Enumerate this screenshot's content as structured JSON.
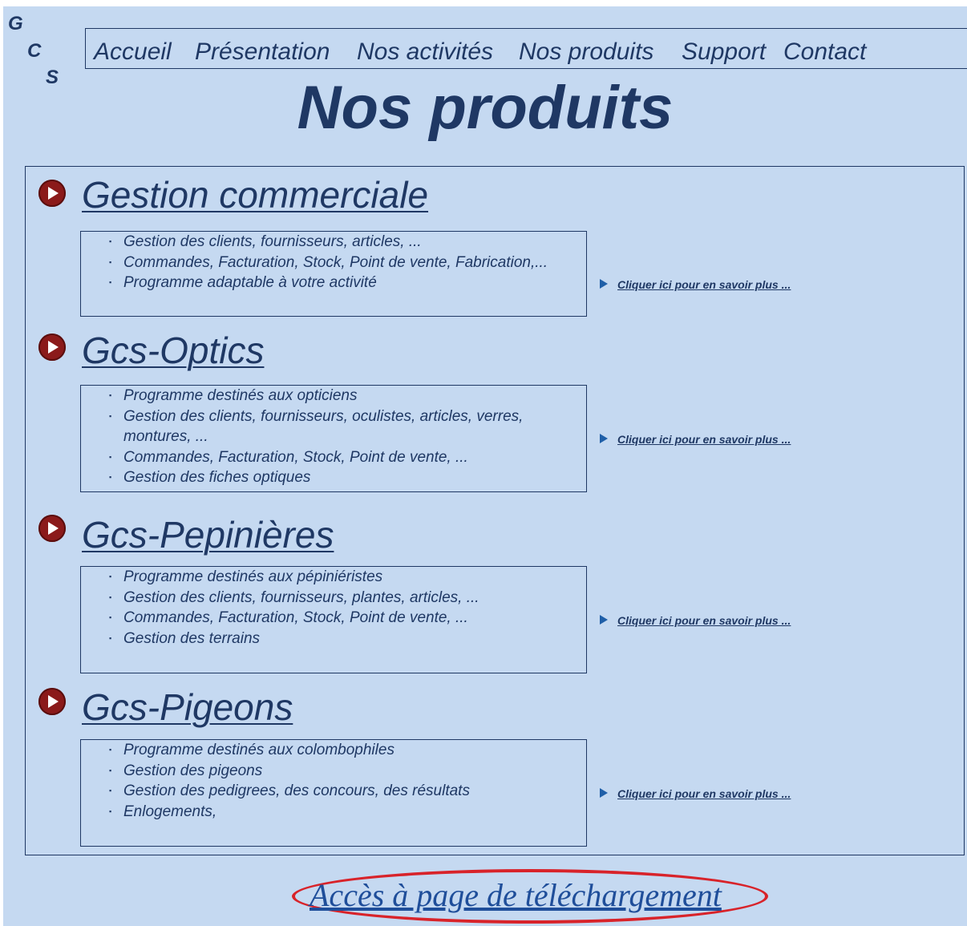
{
  "logo": {
    "letters": [
      "G",
      "C",
      "S"
    ]
  },
  "nav": {
    "items": [
      "Accueil",
      "Présentation",
      "Nos activités",
      "Nos produits",
      "Support",
      "Contact"
    ]
  },
  "page_title": "Nos produits",
  "products": [
    {
      "title": "Gestion commerciale",
      "features": [
        "Gestion des clients, fournisseurs, articles, ...",
        "Commandes, Facturation, Stock, Point de vente, Fabrication,...",
        "Programme adaptable à votre activité"
      ],
      "more_link": "Cliquer ici pour en savoir plus ..."
    },
    {
      "title": "Gcs-Optics",
      "features": [
        "Programme destinés aux opticiens",
        "Gestion des clients, fournisseurs, oculistes, articles, verres, montures, ...",
        "Commandes, Facturation, Stock, Point de vente, ...",
        "Gestion des fiches optiques"
      ],
      "more_link": "Cliquer ici pour en savoir plus ..."
    },
    {
      "title": "Gcs-Pepinières",
      "features": [
        "Programme destinés aux pépiniéristes",
        "Gestion des clients, fournisseurs, plantes, articles, ...",
        "Commandes, Facturation, Stock, Point de vente, ...",
        "Gestion des terrains"
      ],
      "more_link": "Cliquer ici pour en savoir plus ..."
    },
    {
      "title": "Gcs-Pigeons",
      "features": [
        "Programme destinés aux colombophiles",
        "Gestion des pigeons",
        "Gestion des pedigrees, des concours, des résultats",
        "Enlogements,"
      ],
      "more_link": "Cliquer ici pour en savoir plus ..."
    }
  ],
  "download_link": "Accès à page de téléchargement",
  "colors": {
    "background": "#c5d9f1",
    "text": "#1f3864",
    "play_icon": "#8b1a1a",
    "highlight_ellipse": "#d8232a",
    "download_link": "#1f4e9a"
  },
  "icons": {
    "product_bullet": "play-circle-icon",
    "more_link_bullet": "triangle-right-icon"
  }
}
